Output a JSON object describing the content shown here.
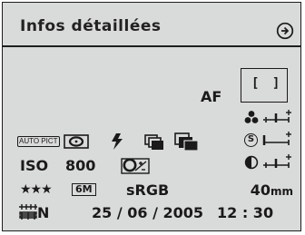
{
  "header": {
    "title": "Infos détaillées",
    "nav_icon": "forward-arrow-circle-icon"
  },
  "focus": {
    "mode_label": "AF",
    "frame_label": "[ ]"
  },
  "modes": {
    "scene_mode": "AUTO PICT",
    "metering_icon": "multi-segment-metering-icon",
    "flash_icon": "flash-icon",
    "drive_icon": "continuous-shooting-icon",
    "bracket_icon": "bracketing-icon"
  },
  "exposure": {
    "iso_label": "ISO",
    "iso_value": "800",
    "wb_icon": "white-balance-icon"
  },
  "quality": {
    "stars": "★★★",
    "size": "6M",
    "color_space": "sRGB",
    "focal_length": "40",
    "focal_unit": "mm"
  },
  "image_params": [
    {
      "name": "saturation",
      "icon": "saturation-icon",
      "level": 0
    },
    {
      "name": "sharpness",
      "icon": "sharpness-icon",
      "level": -2
    },
    {
      "name": "contrast",
      "icon": "contrast-icon",
      "level": 0
    }
  ],
  "footer": {
    "world_time_icon": "world-time-icon",
    "world_time_mode": "N",
    "date": "25 / 06 / 2005",
    "time": "12 : 30"
  }
}
